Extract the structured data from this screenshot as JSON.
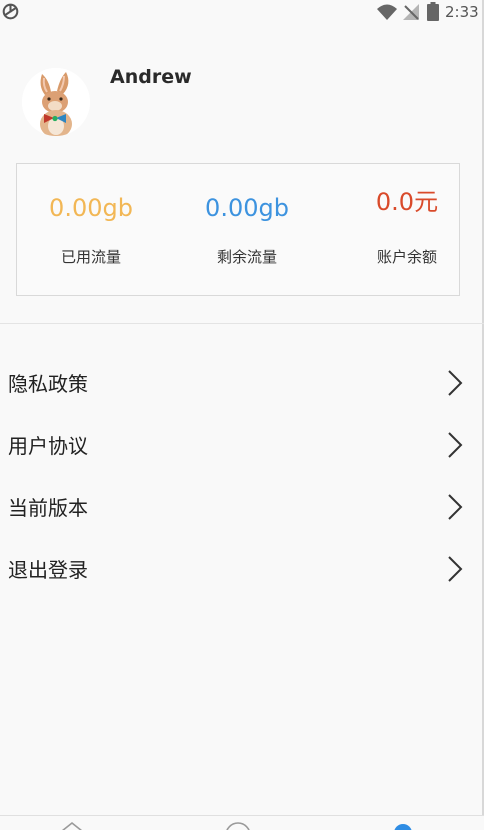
{
  "status_bar": {
    "time": "2:33",
    "icons": [
      "app-sync-icon",
      "wifi-icon",
      "no-signal-icon",
      "battery-icon"
    ]
  },
  "profile": {
    "user_name": "Andrew",
    "avatar": "rabbit-with-bowtie-avatar"
  },
  "stats": [
    {
      "value": "0.00gb",
      "label": "已用流量",
      "color": "#F2B755"
    },
    {
      "value": "0.00gb",
      "label": "剩余流量",
      "color": "#3D93DF"
    },
    {
      "value": "0.0元",
      "label": "账户余额",
      "color": "#D94A2A"
    }
  ],
  "menu": [
    {
      "label": "隐私政策",
      "icon": "chevron-right-icon"
    },
    {
      "label": "用户协议",
      "icon": "chevron-right-icon"
    },
    {
      "label": "当前版本",
      "icon": "chevron-right-icon"
    },
    {
      "label": "退出登录",
      "icon": "chevron-right-icon"
    }
  ],
  "bottom_nav": {
    "tabs": [
      "home-tab",
      "discover-tab",
      "me-tab"
    ],
    "active_color": "#2F8DE4"
  }
}
